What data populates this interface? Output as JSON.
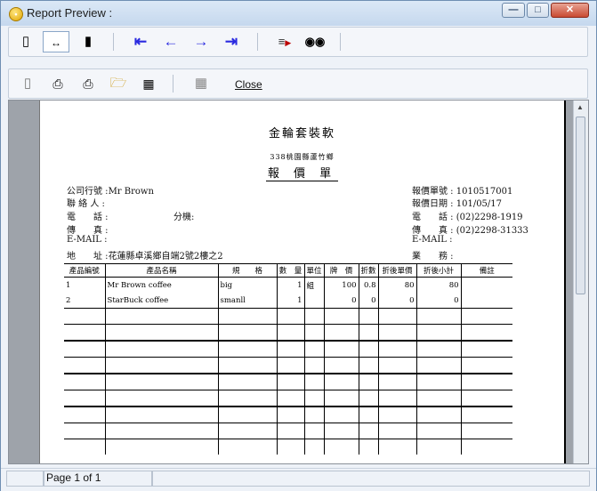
{
  "window": {
    "title": "Report Preview :"
  },
  "toolbar2": {
    "close_label": "Close"
  },
  "report": {
    "company": "金輪套裝軟",
    "address_line": "338桃園縣蘆竹鄉",
    "doc_title": "報 價 單",
    "left_fields": [
      {
        "label": "公司行號",
        "value": "Mr Brown"
      },
      {
        "label": "聯 絡 人",
        "value": ""
      },
      {
        "label": "電　　話",
        "value": ""
      },
      {
        "label": "傳　　真",
        "value": ""
      },
      {
        "label": "E-MAIL",
        "value": ""
      },
      {
        "label": "地　　址",
        "value": "花蓮縣卓溪鄉自端2號2樓之2"
      }
    ],
    "ext_label": "分機:",
    "right_fields": [
      {
        "label": "報價單號",
        "value": "1010517001"
      },
      {
        "label": "報價日期",
        "value": "101/05/17"
      },
      {
        "label": "電　　話",
        "value": "(02)2298-1919"
      },
      {
        "label": "傳　　真",
        "value": "(02)2298-31333"
      },
      {
        "label": "E-MAIL",
        "value": ""
      },
      {
        "label": "業　　務",
        "value": ""
      }
    ],
    "columns": [
      "產品編號",
      "產品名稱",
      "規　　格",
      "數　量",
      "單位",
      "牌　價",
      "折數",
      "折後單價",
      "折後小計",
      "備註"
    ],
    "rows": [
      [
        "1",
        "Mr Brown coffee",
        "big",
        "1",
        "組",
        "100",
        "0.8",
        "80",
        "80",
        ""
      ],
      [
        "2",
        "StarBuck coffee",
        "smanll",
        "1",
        "",
        "0",
        "0",
        "0",
        "0",
        ""
      ]
    ]
  },
  "status": {
    "page_text": "Page 1 of 1"
  }
}
